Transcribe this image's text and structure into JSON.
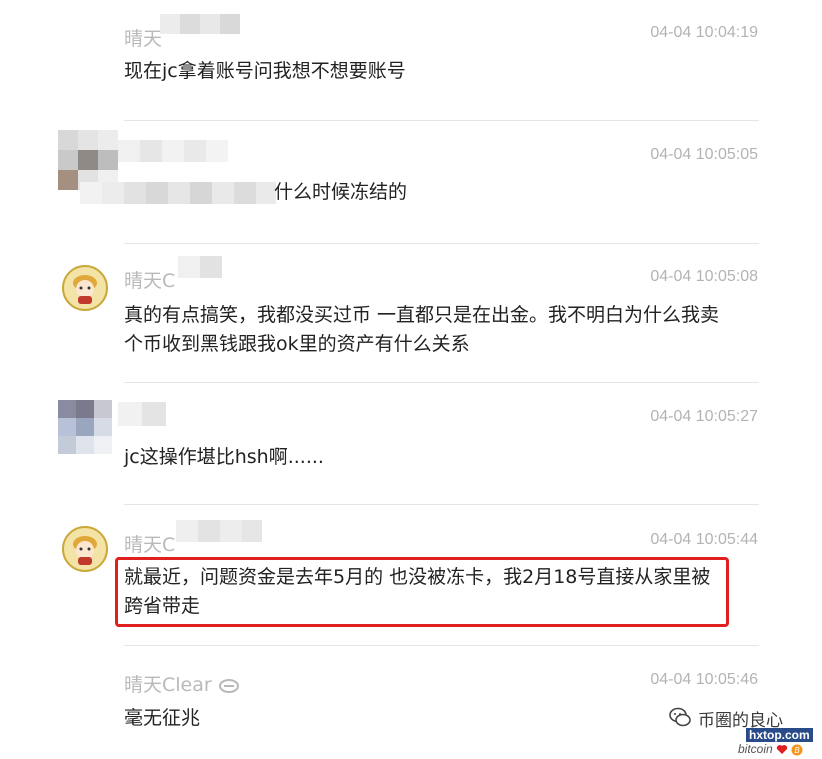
{
  "messages": [
    {
      "name": "晴天",
      "time": "04-04 10:04:19",
      "text": "现在jc拿着账号问我想不想要账号"
    },
    {
      "name": "",
      "time": "04-04 10:05:05",
      "text": "什么时候冻结的"
    },
    {
      "name": "晴天C",
      "time": "04-04 10:05:08",
      "text": "真的有点搞笑，我都没买过币 一直都只是在出金。我不明白为什么我卖个币收到黑钱跟我ok里的资产有什么关系"
    },
    {
      "name": "",
      "time": "04-04 10:05:27",
      "text": "jc这操作堪比hsh啊......"
    },
    {
      "name": "晴天C",
      "time": "04-04 10:05:44",
      "text": "就最近，问题资金是去年5月的 也没被冻卡，我2月18号直接从家里被跨省带走"
    },
    {
      "name": "晴天Clear",
      "time": "04-04 10:05:46",
      "text": "毫无征兆"
    }
  ],
  "watermark": {
    "title": "币圈的良心",
    "site": "hxtop.com",
    "sub": "bitcoin",
    "icon": "wechat-icon"
  },
  "colors": {
    "highlight": "#e02020",
    "name": "#b9b9b9",
    "time": "#b3b3b3"
  }
}
